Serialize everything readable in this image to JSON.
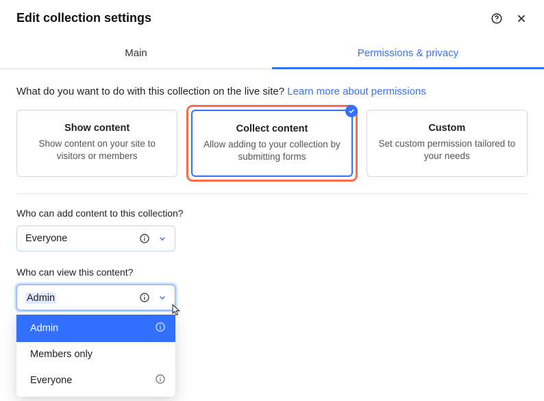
{
  "header": {
    "title": "Edit collection settings"
  },
  "tabs": {
    "main": "Main",
    "permissions": "Permissions & privacy"
  },
  "prompt": {
    "question": "What do you want to do with this collection on the live site? ",
    "link": "Learn more about permissions"
  },
  "cards": [
    {
      "title": "Show content",
      "desc": "Show content on your site to visitors or members"
    },
    {
      "title": "Collect content",
      "desc": "Allow adding to your collection by submitting forms"
    },
    {
      "title": "Custom",
      "desc": "Set custom permission tailored to your needs"
    }
  ],
  "addField": {
    "label": "Who can add content to this collection?",
    "value": "Everyone"
  },
  "viewField": {
    "label": "Who can view this content?",
    "value": "Admin",
    "options": [
      "Admin",
      "Members only",
      "Everyone"
    ]
  }
}
